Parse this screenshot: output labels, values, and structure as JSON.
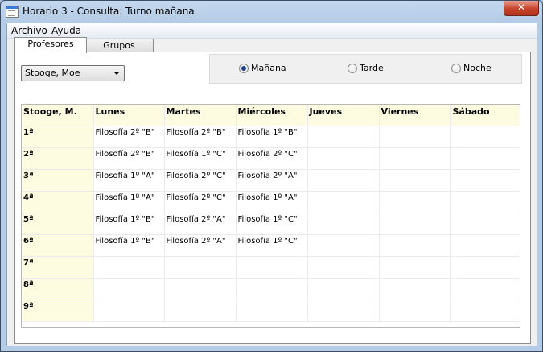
{
  "window": {
    "title": "Horario 3 - Consulta: Turno mañana",
    "close_icon": "close-icon"
  },
  "menu": [
    {
      "label": "Archivo",
      "accel": "A",
      "rest": "rchivo"
    },
    {
      "label": "Ayuda",
      "accel": "y",
      "pre": "A",
      "rest": "uda"
    }
  ],
  "tabs": {
    "active": "Profesores",
    "inactive": "Grupos"
  },
  "teacher_select": {
    "value": "Stooge, Moe"
  },
  "shifts": [
    {
      "label": "Mañana",
      "selected": true
    },
    {
      "label": "Tarde",
      "selected": false
    },
    {
      "label": "Noche",
      "selected": false
    }
  ],
  "schedule": {
    "corner": "Stooge, M.",
    "days": [
      "Lunes",
      "Martes",
      "Miércoles",
      "Jueves",
      "Viernes",
      "Sábado"
    ],
    "rows": [
      {
        "period": "1ª",
        "cells": [
          "Filosofía 2º \"B\"",
          "Filosofía 2º \"B\"",
          "Filosofía 1º \"B\"",
          "",
          "",
          ""
        ]
      },
      {
        "period": "2ª",
        "cells": [
          "Filosofía 2º \"B\"",
          "Filosofía 1º \"C\"",
          "Filosofía 2º \"C\"",
          "",
          "",
          ""
        ]
      },
      {
        "period": "3ª",
        "cells": [
          "Filosofía 1º \"A\"",
          "Filosofía 2º \"C\"",
          "Filosofía 2º \"A\"",
          "",
          "",
          ""
        ]
      },
      {
        "period": "4ª",
        "cells": [
          "Filosofía 1º \"A\"",
          "Filosofía 2º \"C\"",
          "Filosofía 1º \"A\"",
          "",
          "",
          ""
        ]
      },
      {
        "period": "5ª",
        "cells": [
          "Filosofía 1º \"B\"",
          "Filosofía 2º \"A\"",
          "Filosofía 1º \"C\"",
          "",
          "",
          ""
        ]
      },
      {
        "period": "6ª",
        "cells": [
          "Filosofía 1º \"B\"",
          "Filosofía 2º \"A\"",
          "Filosofía 1º \"C\"",
          "",
          "",
          ""
        ]
      },
      {
        "period": "7ª",
        "cells": [
          "",
          "",
          "",
          "",
          "",
          ""
        ]
      },
      {
        "period": "8ª",
        "cells": [
          "",
          "",
          "",
          "",
          "",
          ""
        ]
      },
      {
        "period": "9ª",
        "cells": [
          "",
          "",
          "",
          "",
          "",
          ""
        ]
      }
    ]
  }
}
